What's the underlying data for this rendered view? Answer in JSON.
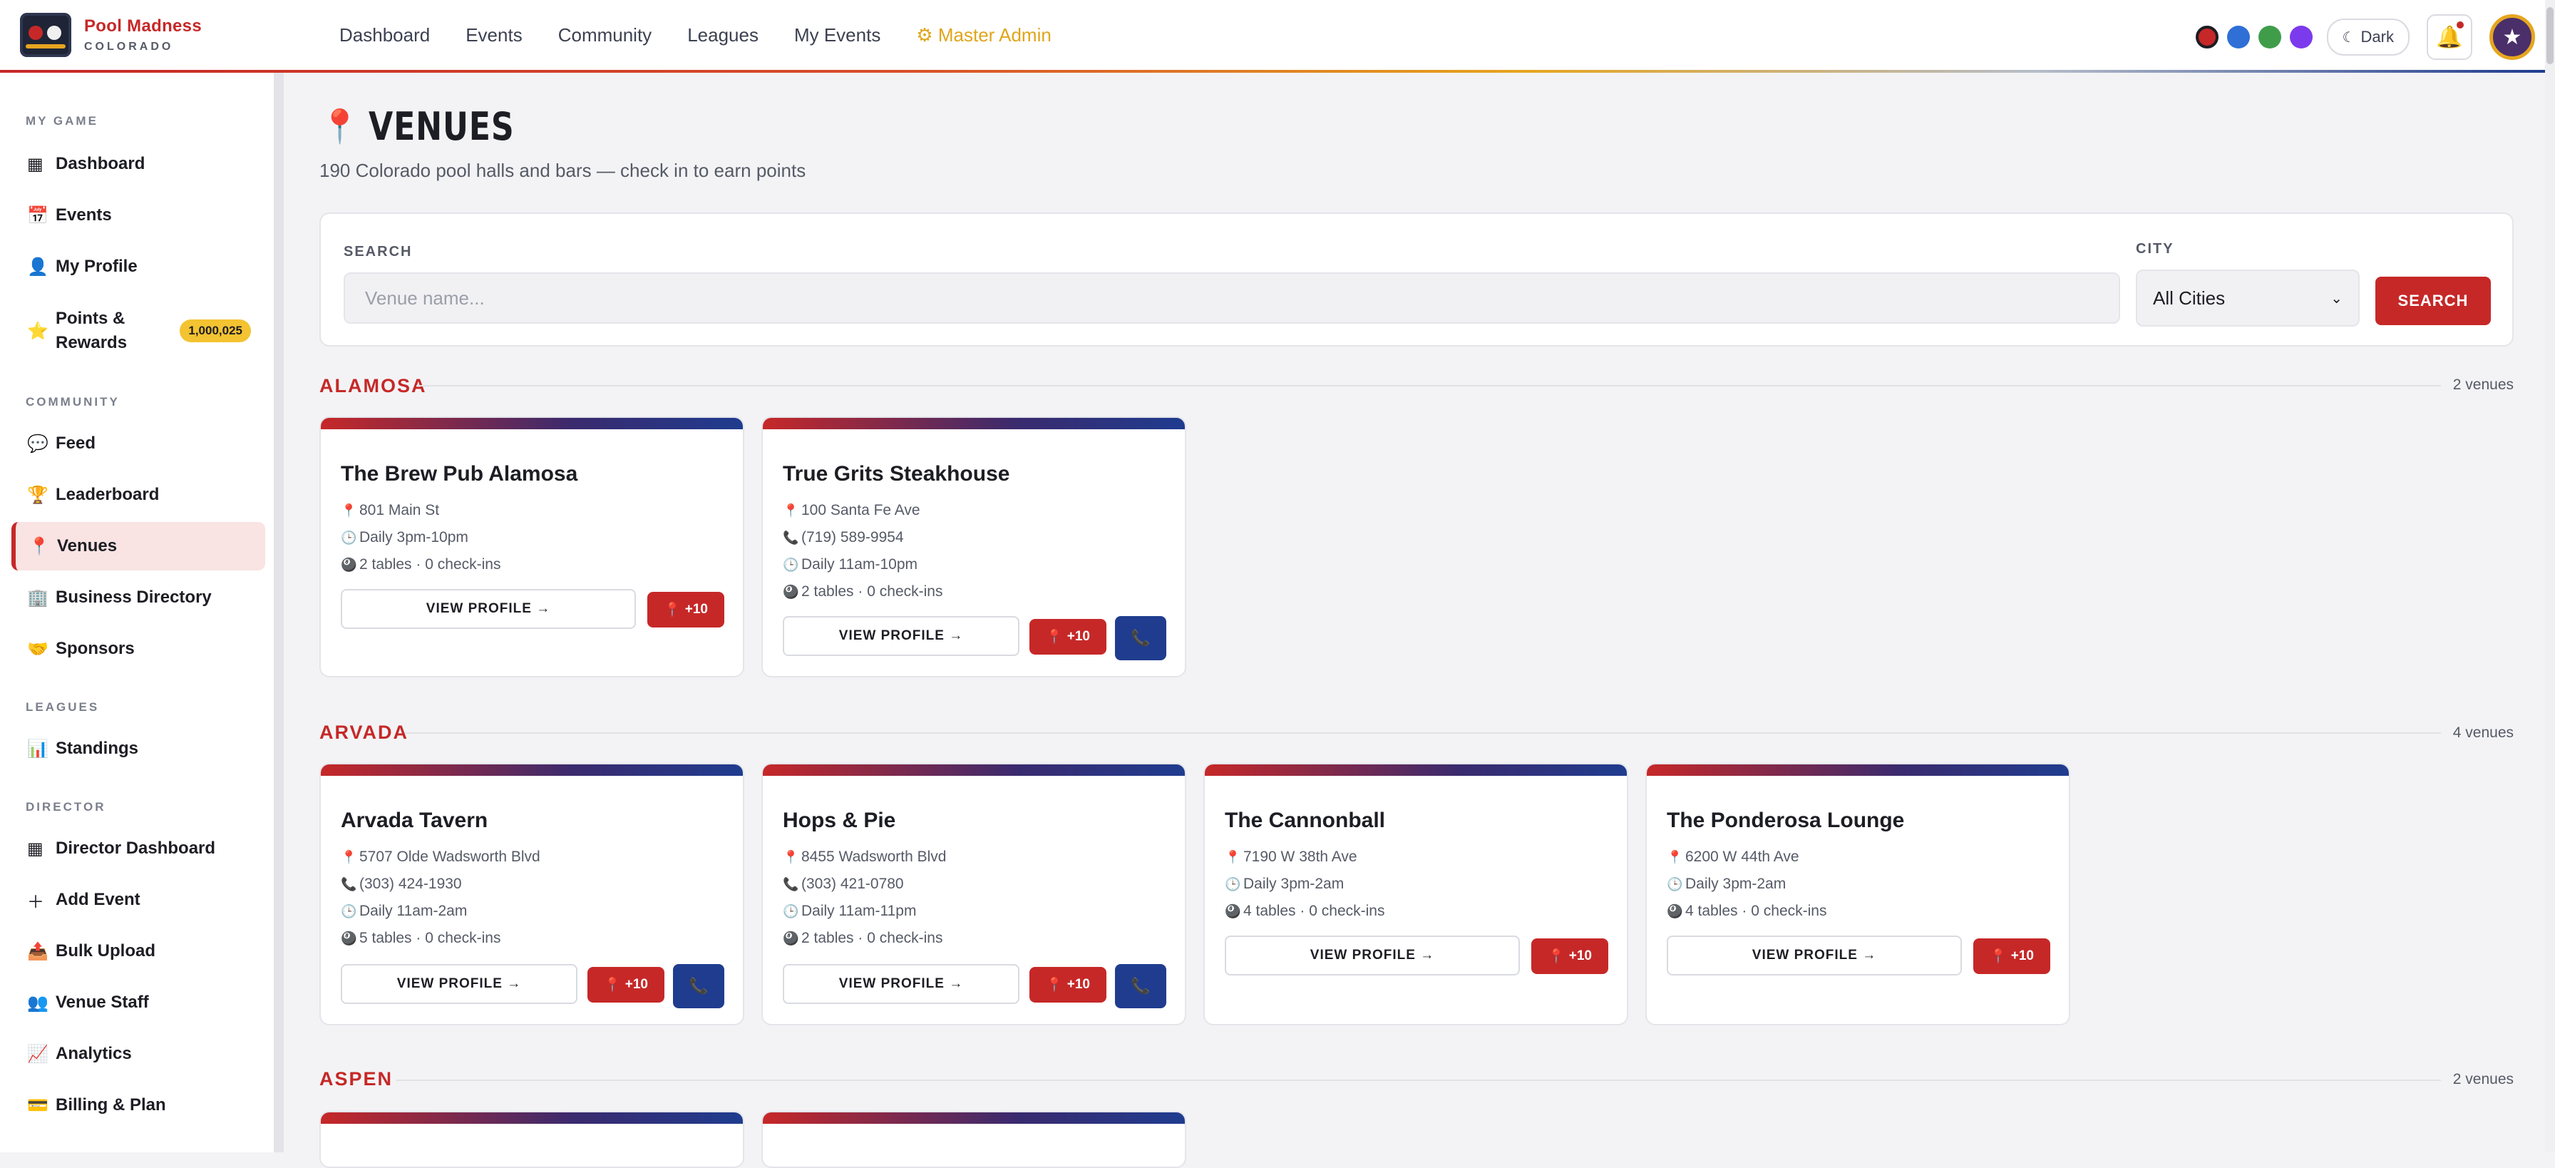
{
  "brand": {
    "name": "Pool Madness",
    "sub": "COLORADO"
  },
  "nav": [
    {
      "label": "Dashboard"
    },
    {
      "label": "Events"
    },
    {
      "label": "Community"
    },
    {
      "label": "Leagues"
    },
    {
      "label": "My Events"
    },
    {
      "label": "⚙ Master Admin"
    }
  ],
  "theme": {
    "swatches": [
      "#c62828",
      "#2f6fd6",
      "#3f9d4a",
      "#7c3aed"
    ],
    "dark_label": "Dark"
  },
  "sidebar": {
    "sections": [
      {
        "title": "MY GAME",
        "items": [
          {
            "label": "Dashboard",
            "icon": "grid-icon"
          },
          {
            "label": "Events",
            "icon": "calendar-icon"
          },
          {
            "label": "My Profile",
            "icon": "user-icon"
          },
          {
            "label": "Points & Rewards",
            "icon": "star-icon",
            "badge": "1,000,025"
          }
        ]
      },
      {
        "title": "COMMUNITY",
        "items": [
          {
            "label": "Feed",
            "icon": "speech-icon"
          },
          {
            "label": "Leaderboard",
            "icon": "trophy-icon"
          },
          {
            "label": "Venues",
            "icon": "pin-icon",
            "active": true
          },
          {
            "label": "Business Directory",
            "icon": "building-icon"
          },
          {
            "label": "Sponsors",
            "icon": "handshake-icon"
          }
        ]
      },
      {
        "title": "LEAGUES",
        "items": [
          {
            "label": "Standings",
            "icon": "bar-chart-icon"
          }
        ]
      },
      {
        "title": "DIRECTOR",
        "items": [
          {
            "label": "Director Dashboard",
            "icon": "grid-icon"
          },
          {
            "label": "Add Event",
            "icon": "plus-icon"
          },
          {
            "label": "Bulk Upload",
            "icon": "upload-icon"
          },
          {
            "label": "Venue Staff",
            "icon": "people-icon"
          },
          {
            "label": "Analytics",
            "icon": "trend-icon"
          },
          {
            "label": "Billing & Plan",
            "icon": "card-icon"
          }
        ]
      }
    ]
  },
  "page": {
    "title": "VENUES",
    "subtitle": "190 Colorado pool halls and bars — check in to earn points"
  },
  "search": {
    "label": "SEARCH",
    "placeholder": "Venue name...",
    "value": "",
    "city_label": "CITY",
    "city_value": "All Cities",
    "button": "SEARCH"
  },
  "cities": [
    {
      "name": "ALAMOSA",
      "count": "2 venues",
      "venues": [
        {
          "name": "The Brew Pub Alamosa",
          "address": "801 Main St",
          "phone": "",
          "hours": "Daily 3pm-10pm",
          "tables": "2 tables",
          "checkins": "0 check-ins"
        },
        {
          "name": "True Grits Steakhouse",
          "address": "100 Santa Fe Ave",
          "phone": "(719) 589-9954",
          "hours": "Daily 11am-10pm",
          "tables": "2 tables",
          "checkins": "0 check-ins"
        }
      ]
    },
    {
      "name": "ARVADA",
      "count": "4 venues",
      "venues": [
        {
          "name": "Arvada Tavern",
          "address": "5707 Olde Wadsworth Blvd",
          "phone": "(303) 424-1930",
          "hours": "Daily 11am-2am",
          "tables": "5 tables",
          "checkins": "0 check-ins"
        },
        {
          "name": "Hops & Pie",
          "address": "8455 Wadsworth Blvd",
          "phone": "(303) 421-0780",
          "hours": "Daily 11am-11pm",
          "tables": "2 tables",
          "checkins": "0 check-ins"
        },
        {
          "name": "The Cannonball",
          "address": "7190 W 38th Ave",
          "phone": "",
          "hours": "Daily 3pm-2am",
          "tables": "4 tables",
          "checkins": "0 check-ins"
        },
        {
          "name": "The Ponderosa Lounge",
          "address": "6200 W 44th Ave",
          "phone": "",
          "hours": "Daily 3pm-2am",
          "tables": "4 tables",
          "checkins": "0 check-ins"
        }
      ]
    },
    {
      "name": "ASPEN",
      "count": "2 venues",
      "venues": []
    }
  ],
  "card_labels": {
    "view": "VIEW PROFILE →",
    "checkin": "+10",
    "sep": "·"
  }
}
